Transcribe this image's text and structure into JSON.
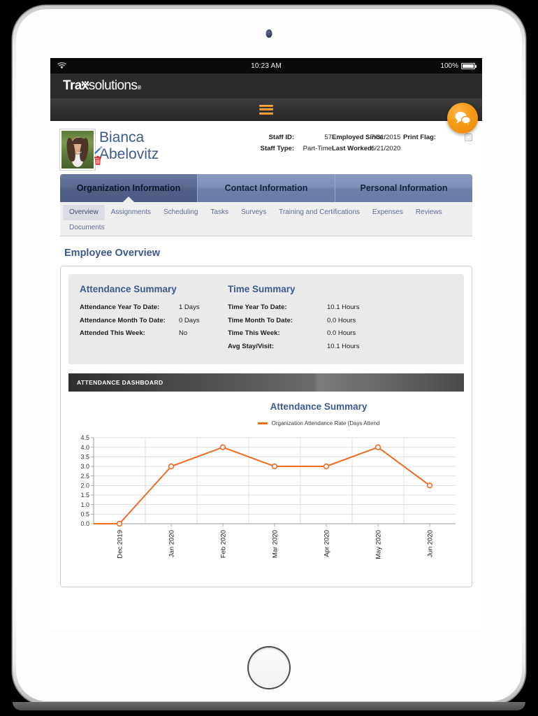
{
  "status_bar": {
    "wifi_icon": "wifi-icon",
    "time": "10:23 AM",
    "battery_percent": "100%",
    "battery_icon": "battery-full-icon"
  },
  "brand": {
    "logo_text_bold": "Trax",
    "logo_text_light": "olutions",
    "logo_text_s": "s",
    "registered": "®"
  },
  "nav": {
    "menu_icon": "hamburger-menu-icon",
    "chat_icon": "chat-bubbles-icon"
  },
  "employee": {
    "avatar_alt": "employee-photo",
    "first_name": "Bianca",
    "last_name": "Abelovitz",
    "edit_icon": "pencil-edit-icon",
    "delete_icon": "trash-delete-icon",
    "fields": {
      "staff_id_label": "Staff ID:",
      "staff_id_value": "57",
      "staff_type_label": "Staff Type:",
      "staff_type_value": "Part-Time",
      "employed_since_label": "Employed Since:",
      "employed_since_value": "7/31/2015",
      "last_worked_label": "Last Worked:",
      "last_worked_value": "6/21/2020",
      "print_flag_label": "Print Flag:",
      "print_flag_checked": false
    }
  },
  "main_tabs": [
    {
      "label": "Organization Information",
      "active": true
    },
    {
      "label": "Contact Information",
      "active": false
    },
    {
      "label": "Personal Information",
      "active": false
    }
  ],
  "sub_tabs": [
    {
      "label": "Overview",
      "active": true
    },
    {
      "label": "Assignments",
      "active": false
    },
    {
      "label": "Scheduling",
      "active": false
    },
    {
      "label": "Tasks",
      "active": false
    },
    {
      "label": "Surveys",
      "active": false
    },
    {
      "label": "Training and Certifications",
      "active": false
    },
    {
      "label": "Expenses",
      "active": false
    },
    {
      "label": "Reviews",
      "active": false
    },
    {
      "label": "Documents",
      "active": false
    }
  ],
  "page_title": "Employee Overview",
  "attendance_summary": {
    "heading": "Attendance Summary",
    "rows": [
      {
        "label": "Attendance Year To Date:",
        "value": "1 Days"
      },
      {
        "label": "Attendance Month To Date:",
        "value": "0 Days"
      },
      {
        "label": "Attended This Week:",
        "value": "No"
      }
    ]
  },
  "time_summary": {
    "heading": "Time Summary",
    "rows": [
      {
        "label": "Time Year To Date:",
        "value": "10.1 Hours"
      },
      {
        "label": "Time Month To Date:",
        "value": "0.0 Hours"
      },
      {
        "label": "Time This Week:",
        "value": "0.0 Hours"
      },
      {
        "label": "Avg Stay/Visit:",
        "value": "10.1 Hours"
      }
    ]
  },
  "dashboard_strip": {
    "label": "ATTENDANCE DASHBOARD"
  },
  "colors": {
    "brand_orange": "#ef8a0c",
    "series_orange": "#ee6b22",
    "heading_blue": "#3c5a8f",
    "tab_blue": "#6e7fa8",
    "tab_blue_active": "#515f87"
  },
  "chart_data": {
    "type": "line",
    "title": "Attendance Summary",
    "legend": [
      "Organization Attendance Rate (Days Attend"
    ],
    "legend_position": "top",
    "categories": [
      "Dec 2019",
      "Jan 2020",
      "Feb 2020",
      "Mar 2020",
      "Apr 2020",
      "May 2020",
      "Jun 2020"
    ],
    "series": [
      {
        "name": "Organization Attendance Rate (Days Attend",
        "values": [
          0.0,
          3.0,
          4.0,
          3.0,
          3.0,
          4.0,
          2.0
        ]
      }
    ],
    "ylim": [
      0.0,
      4.5
    ],
    "ytick_labels": [
      "0.0",
      "0.5",
      "1.0",
      "1.5",
      "2.0",
      "2.5",
      "3.0",
      "3.5",
      "4.0",
      "4.5"
    ],
    "xlabel": "",
    "ylabel": "",
    "grid": true,
    "marker": "open-circle"
  }
}
